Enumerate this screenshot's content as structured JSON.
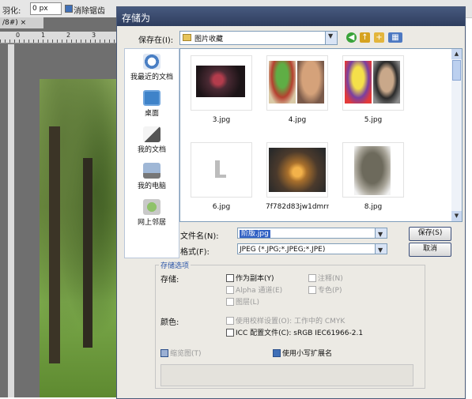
{
  "background": {
    "feather_label": "羽化:",
    "feather_value": "0 px",
    "antialias_label": "消除锯齿",
    "doc_tab": "/8#) ×",
    "ruler_ticks": [
      "0",
      "1",
      "2",
      "3"
    ]
  },
  "dialog": {
    "title": "存储为",
    "save_in_label": "保存在(I):",
    "save_in_value": "图片收藏",
    "places": [
      {
        "label": "我最近的文档",
        "icon": "recent-documents-icon"
      },
      {
        "label": "桌面",
        "icon": "desktop-icon"
      },
      {
        "label": "我的文档",
        "icon": "my-documents-icon"
      },
      {
        "label": "我的电脑",
        "icon": "my-computer-icon"
      },
      {
        "label": "网上邻居",
        "icon": "network-places-icon"
      }
    ],
    "files": [
      {
        "name": "3.jpg"
      },
      {
        "name": "4.jpg"
      },
      {
        "name": "5.jpg"
      },
      {
        "name": "6.jpg"
      },
      {
        "name": "7f782d83jw1dmrnafgl..."
      },
      {
        "name": "8.jpg"
      }
    ],
    "filename_label": "文件名(N):",
    "filename_value": "阶版.jpg",
    "format_label": "格式(F):",
    "format_value": "JPEG (*.JPG;*.JPEG;*.JPE)",
    "save_button": "保存(S)",
    "cancel_button": "取消",
    "options_legend": "存储选项",
    "storage_label": "存储:",
    "as_copy": "作为副本(Y)",
    "annotations": "注释(N)",
    "alpha": "Alpha 通道(E)",
    "spot_color": "专色(P)",
    "layers": "图层(L)",
    "color_label": "颜色:",
    "use_proof": "使用校样设置(O): 工作中的 CMYK",
    "icc_profile": "ICC 配置文件(C): sRGB IEC61966-2.1",
    "thumbnail": "缩览图(T)",
    "lowercase_ext": "使用小写扩展名"
  }
}
